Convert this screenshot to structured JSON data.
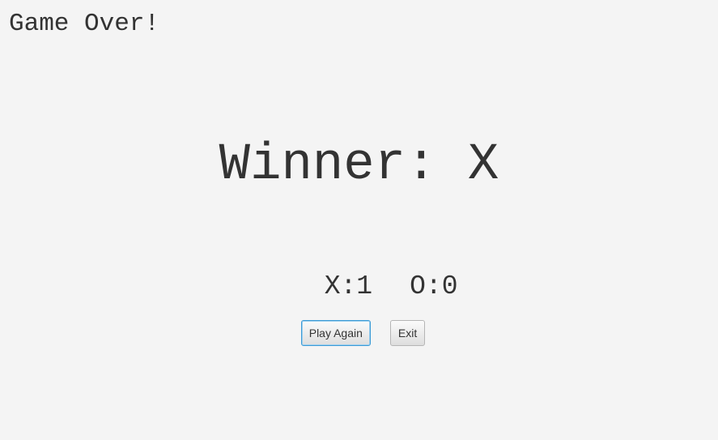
{
  "screen": {
    "title": "Game Over!",
    "winner_text": "Winner: X"
  },
  "score": {
    "x": "X:1",
    "o": "O:0"
  },
  "actions": {
    "play_again_label": "Play Again",
    "exit_label": "Exit"
  },
  "colors": {
    "background": "#f4f4f4",
    "text": "#333333",
    "focus_ring": "#3c9bd6"
  }
}
